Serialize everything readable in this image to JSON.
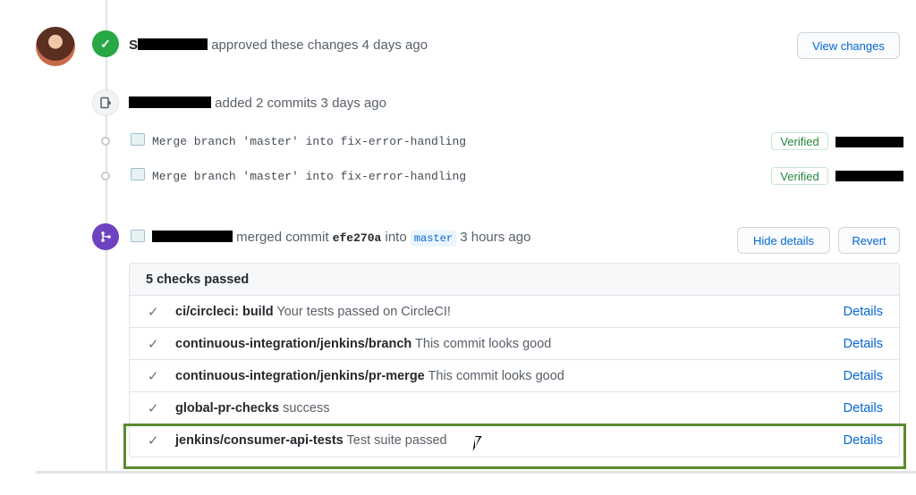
{
  "approval": {
    "user_initial": "S",
    "text": "approved these changes 4 days ago",
    "button": "View changes",
    "icon": "check-icon"
  },
  "commits_event": {
    "text": "added 2 commits 3 days ago",
    "icon": "push-icon",
    "commits": [
      {
        "message": "Merge branch 'master' into fix-error-handling",
        "badge": "Verified"
      },
      {
        "message": "Merge branch 'master' into fix-error-handling",
        "badge": "Verified"
      }
    ]
  },
  "merge_event": {
    "prefix": "merged commit",
    "sha": "efe270a",
    "into": "into",
    "branch": "master",
    "time": "3 hours ago",
    "hide_button": "Hide details",
    "revert_button": "Revert",
    "icon": "merge-icon"
  },
  "checks": {
    "header": "5 checks passed",
    "details_label": "Details",
    "items": [
      {
        "name": "ci/circleci: build",
        "description": "Your tests passed on CircleCI!"
      },
      {
        "name": "continuous-integration/jenkins/branch",
        "description": "This commit looks good"
      },
      {
        "name": "continuous-integration/jenkins/pr-merge",
        "description": "This commit looks good"
      },
      {
        "name": "global-pr-checks",
        "description": "success"
      },
      {
        "name": "jenkins/consumer-api-tests",
        "description": "Test suite passed"
      }
    ]
  },
  "colors": {
    "approve": "#28a745",
    "merge": "#6f42c1",
    "link": "#0366d6",
    "highlight": "#5b8a2f"
  }
}
